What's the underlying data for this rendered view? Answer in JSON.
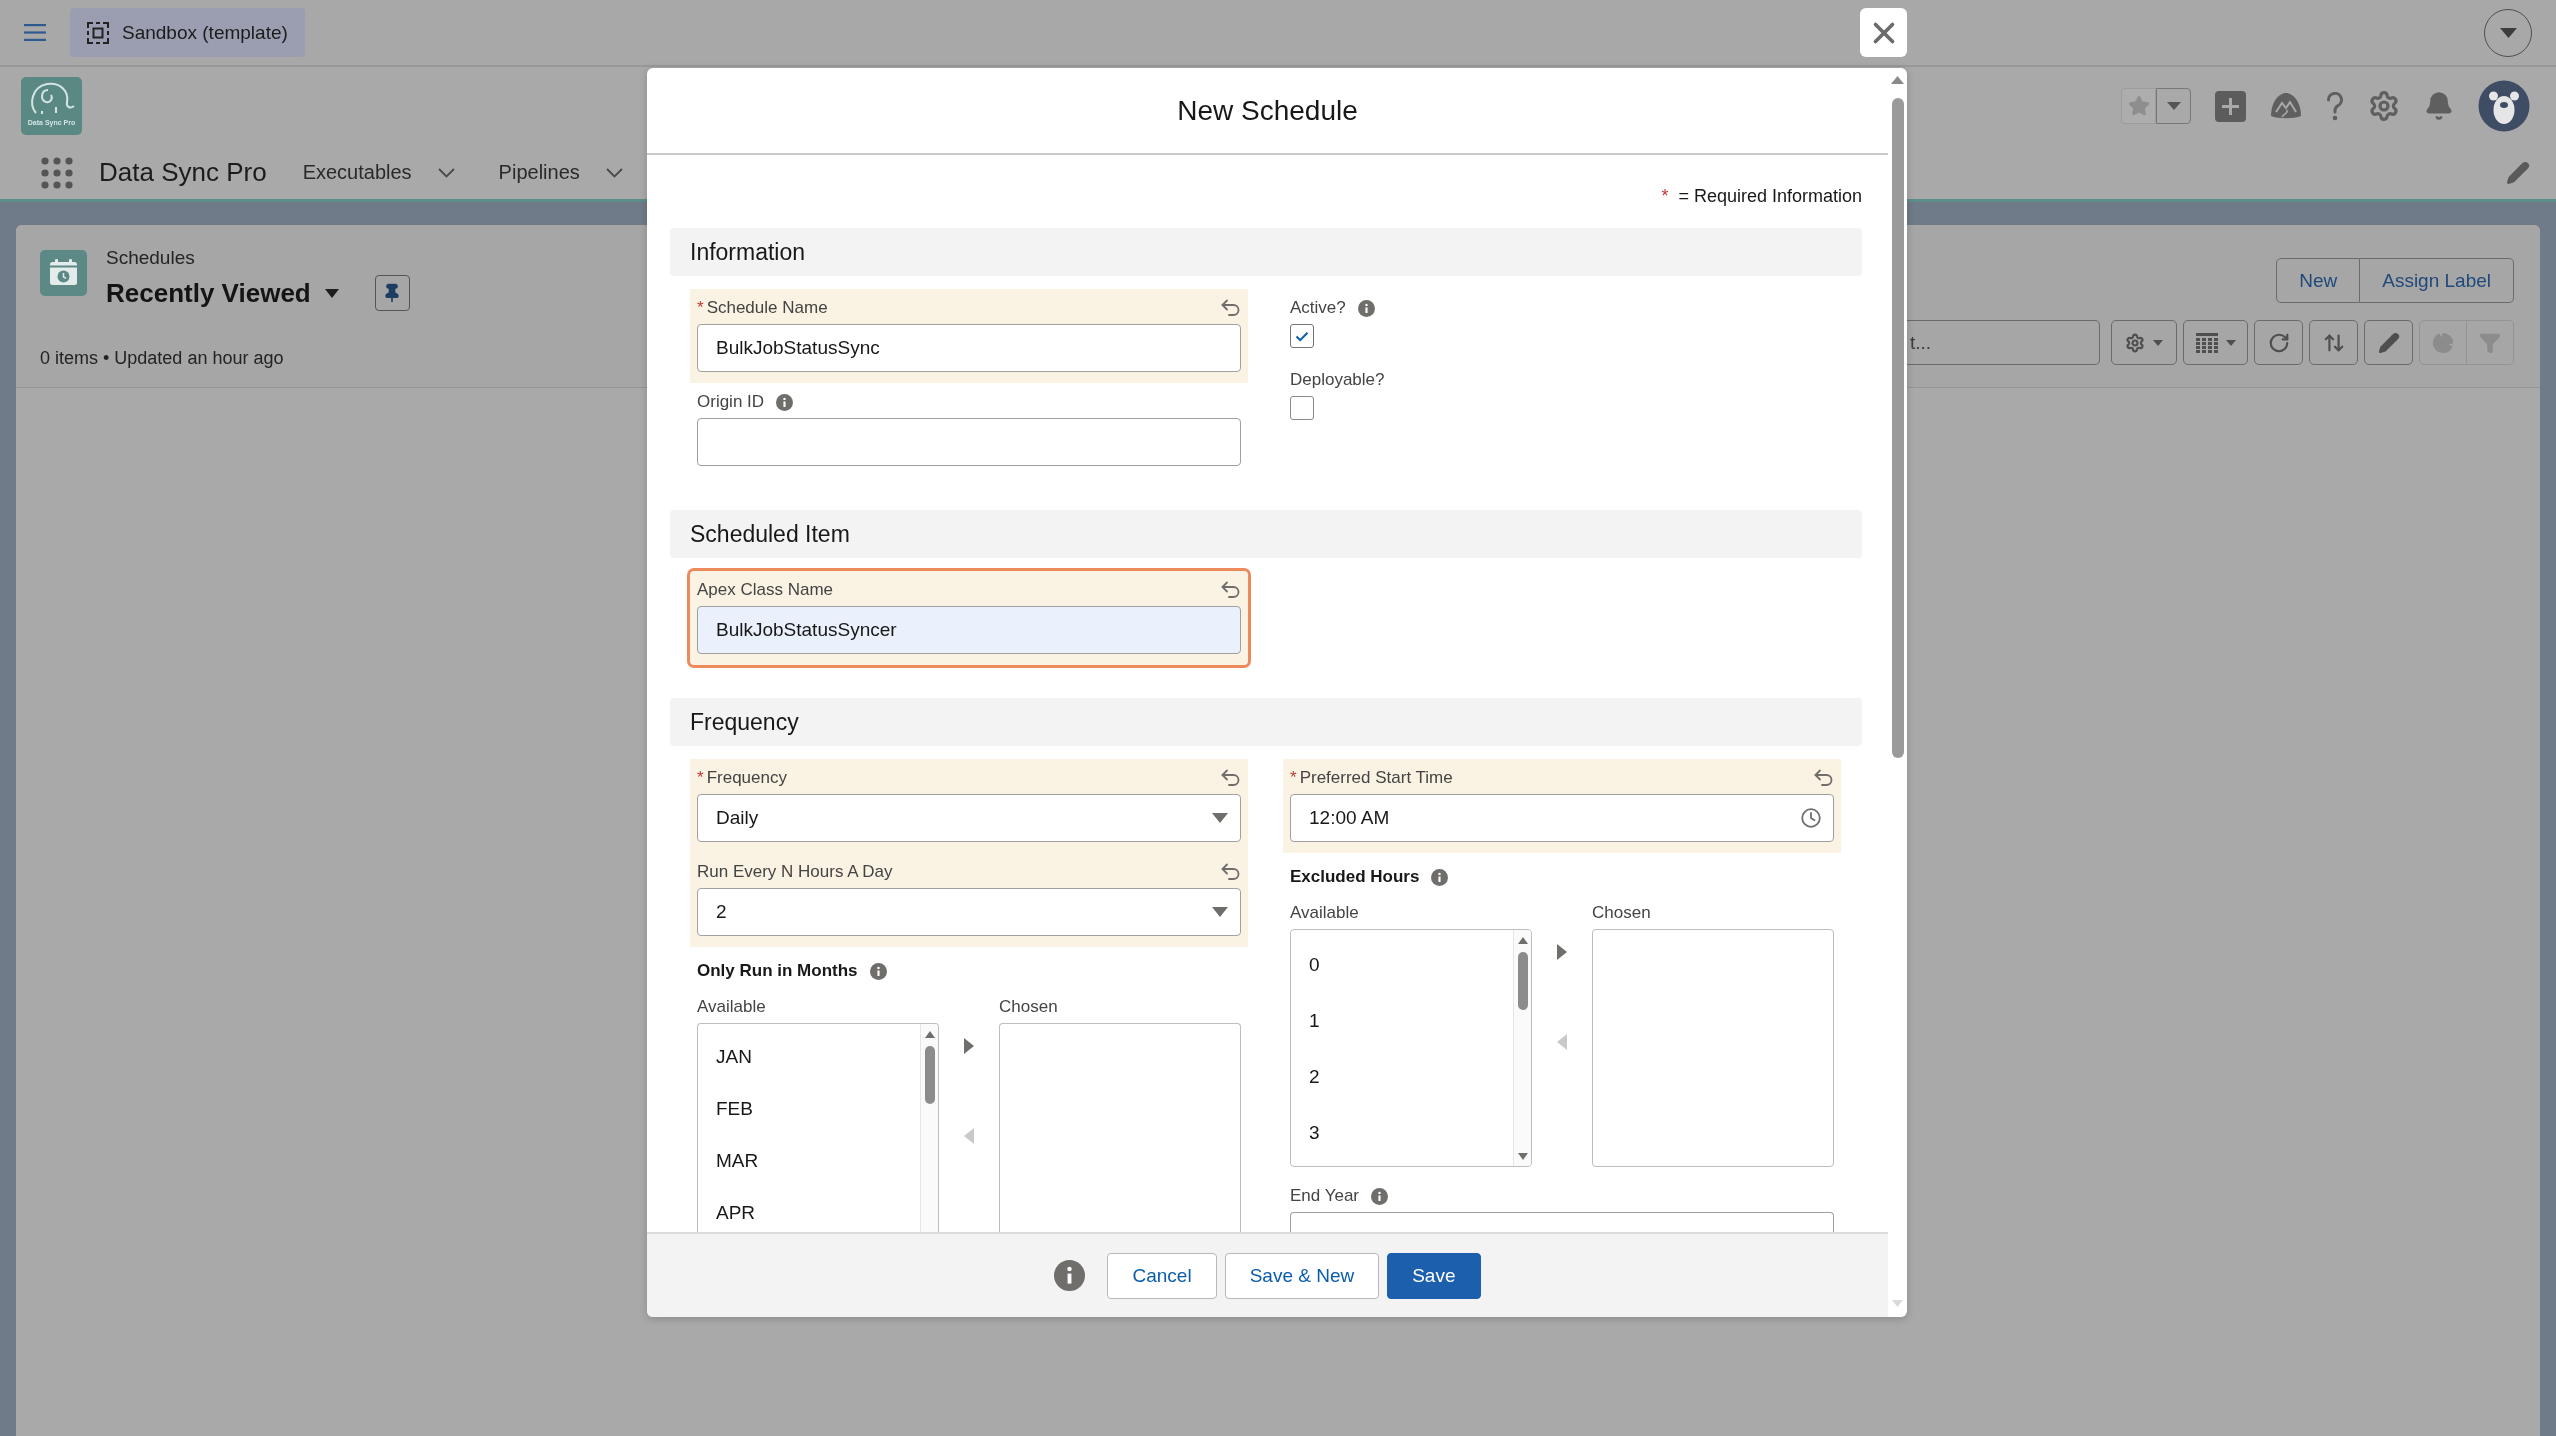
{
  "top_bar": {
    "sandbox_label": "Sandbox (template)"
  },
  "header": {
    "logo_caption": "Data Sync Pro",
    "app_name": "Data Sync Pro",
    "nav_items": [
      {
        "label": "Executables"
      },
      {
        "label": "Pipelines"
      }
    ]
  },
  "list_view": {
    "object_name": "Schedules",
    "view_name": "Recently Viewed",
    "status": "0 items • Updated an hour ago",
    "actions": [
      {
        "label": "New"
      },
      {
        "label": "Assign Label"
      }
    ],
    "search": {
      "placeholder": "t..."
    }
  },
  "modal": {
    "title": "New Schedule",
    "required_legend": {
      "mark": "*",
      "text": "= Required Information"
    },
    "sections": [
      {
        "title": "Information",
        "columns": [
          [
            {
              "kind": "text",
              "label": "Schedule Name",
              "value": "BulkJobStatusSync",
              "required": true,
              "edited": true,
              "focused": false,
              "help": false
            },
            {
              "kind": "text",
              "label": "Origin ID",
              "required": false,
              "edited": false,
              "focused": false,
              "help": true
            }
          ],
          [
            {
              "kind": "checkbox",
              "label": "Active?",
              "checked": true,
              "required": false,
              "edited": false,
              "focused": false,
              "help": true
            },
            {
              "kind": "checkbox",
              "label": "Deployable?",
              "checked": false,
              "required": false,
              "edited": false,
              "focused": false,
              "help": false
            }
          ]
        ]
      },
      {
        "title": "Scheduled Item",
        "columns": [
          [
            {
              "kind": "text",
              "label": "Apex Class Name",
              "value": "BulkJobStatusSyncer",
              "required": false,
              "edited": true,
              "focused": true,
              "help": false
            }
          ]
        ]
      },
      {
        "title": "Frequency",
        "columns": [
          [
            {
              "kind": "picklist",
              "label": "Frequency",
              "value": "Daily",
              "required": true,
              "edited": true,
              "focused": false,
              "help": false
            },
            {
              "kind": "picklist",
              "label": "Run Every N Hours A Day",
              "value": "2",
              "required": false,
              "edited": true,
              "focused": false,
              "help": false
            },
            {
              "kind": "dual_listbox",
              "label": "Only Run in Months",
              "available_label": "Available",
              "chosen_label": "Chosen",
              "options": [
                "JAN",
                "FEB",
                "MAR",
                "APR"
              ],
              "required": false,
              "edited": false,
              "focused": false,
              "help": true
            }
          ],
          [
            {
              "kind": "time",
              "label": "Preferred Start Time",
              "value": "12:00 AM",
              "required": true,
              "edited": true,
              "focused": false,
              "help": false
            },
            {
              "kind": "dual_listbox",
              "label": "Excluded Hours",
              "available_label": "Available",
              "chosen_label": "Chosen",
              "options": [
                "0",
                "1",
                "2",
                "3"
              ],
              "required": false,
              "edited": false,
              "focused": false,
              "help": true
            },
            {
              "kind": "text",
              "label": "End Year",
              "required": false,
              "edited": false,
              "focused": false,
              "help": true
            }
          ]
        ]
      }
    ],
    "footer": {
      "buttons": [
        {
          "label": "Cancel",
          "kind": "neutral"
        },
        {
          "label": "Save & New",
          "kind": "neutral"
        },
        {
          "label": "Save",
          "kind": "brand"
        }
      ]
    }
  }
}
